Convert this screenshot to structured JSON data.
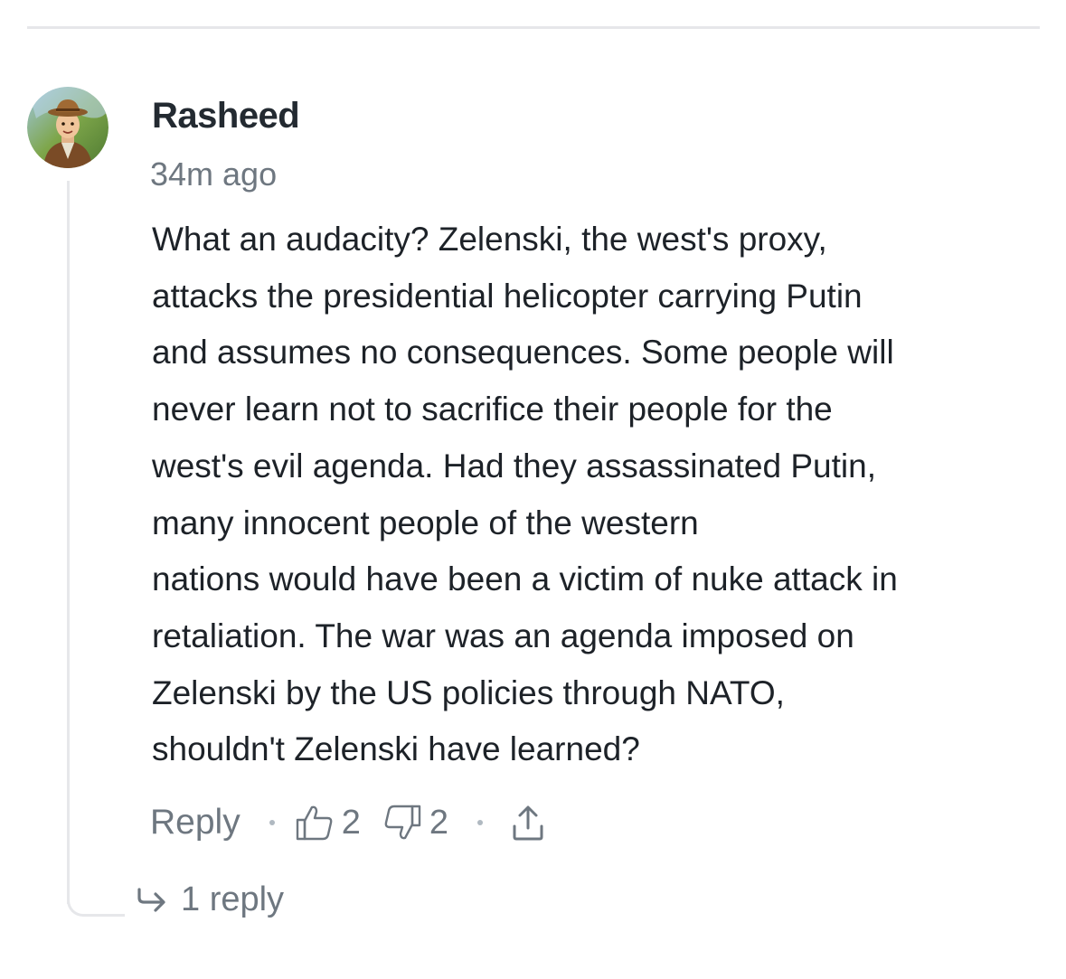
{
  "comment": {
    "author": "Rasheed",
    "timestamp": "34m ago",
    "text": "What an audacity?  Zelenski, the west's proxy,\nattacks the presidential helicopter carrying Putin\nand assumes no consequences.  Some people will\nnever learn not to sacrifice their people for the\nwest's evil agenda.  Had they assassinated Putin,\nmany innocent people of the western\nnations would have been a victim of nuke attack in\nretaliation. The war was an agenda imposed on\nZelenski by the US policies through NATO,\nshouldn't Zelenski have learned?",
    "avatar_icon": "avatar-explorer-icon"
  },
  "actions": {
    "reply_label": "Reply",
    "like_count": "2",
    "dislike_count": "2",
    "like_icon": "thumbs-up-icon",
    "dislike_icon": "thumbs-down-icon",
    "share_icon": "share-icon"
  },
  "replies": {
    "label": "1 reply",
    "icon": "reply-arrow-icon"
  },
  "colors": {
    "text": "#1d2228",
    "muted": "#6e7780",
    "divider": "#e6e7ea"
  }
}
